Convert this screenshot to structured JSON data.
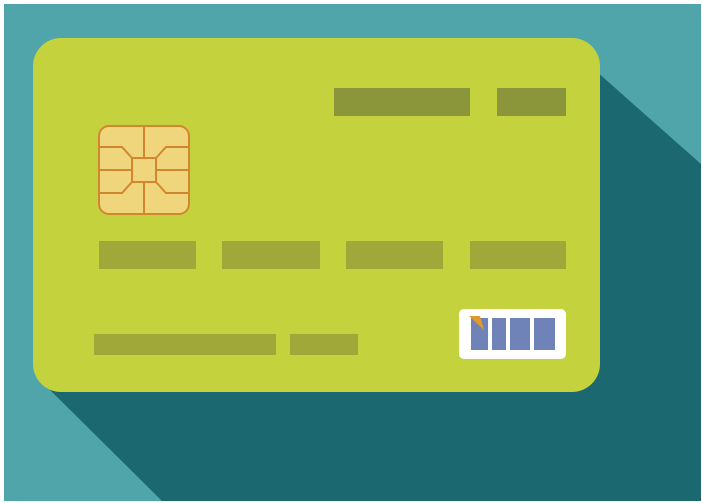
{
  "illustration": {
    "subject": "credit-card-icon",
    "colors": {
      "background": "#4fa5a9",
      "shadow": "#1c6870",
      "card": "#c4d23e",
      "number_blocks": "#9fa838",
      "header_blocks": "#8b963a",
      "chip_fill": "#efd67d",
      "chip_stroke": "#d4862f",
      "logo_box": "#ffffff",
      "logo_bars": "#6f83b8",
      "logo_accent": "#e29a2e"
    }
  }
}
